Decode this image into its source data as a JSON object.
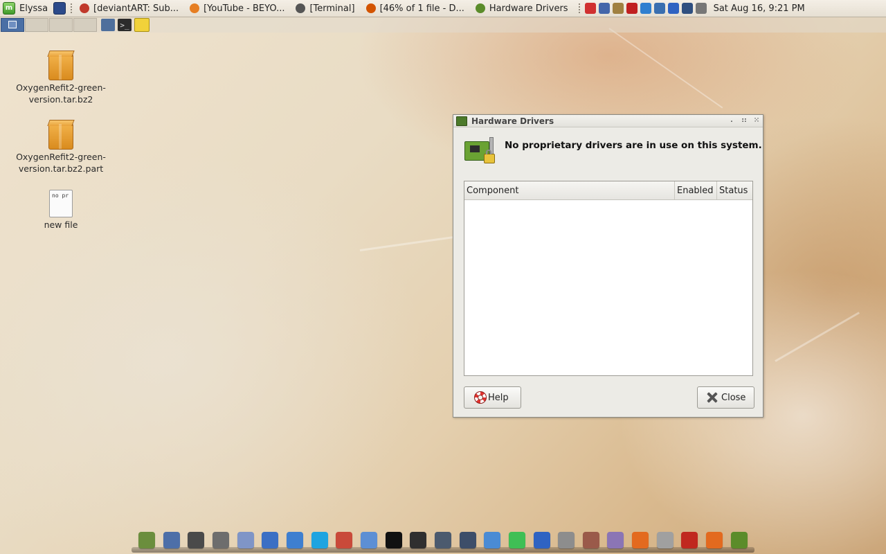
{
  "top_panel": {
    "menu_label": "Elyssa",
    "tasks": [
      {
        "label": "[deviantART: Sub...",
        "icon": "music-player-icon",
        "color": "#c0392b"
      },
      {
        "label": "[YouTube - BEYO...",
        "icon": "firefox-icon",
        "color": "#e67e22"
      },
      {
        "label": "[Terminal]",
        "icon": "terminal-icon",
        "color": "#555555"
      },
      {
        "label": "[46% of 1 file - D...",
        "icon": "download-icon",
        "color": "#d35400"
      },
      {
        "label": "Hardware Drivers",
        "icon": "hardware-drivers-icon",
        "color": "#5b8c2a"
      }
    ],
    "clock": "Sat Aug 16,  9:21 PM"
  },
  "desktop_icons": [
    {
      "line1": "OxygenRefit2-green-",
      "line2": "version.tar.bz2"
    },
    {
      "line1": "OxygenRefit2-green-",
      "line2": "version.tar.bz2.part"
    },
    {
      "line1": "new file",
      "preview": "no pr"
    }
  ],
  "dialog": {
    "title": "Hardware Drivers",
    "message": "No proprietary drivers are in use on this system.",
    "columns": [
      "Component",
      "Enabled",
      "Status"
    ],
    "help_label": "Help",
    "close_label": "Close"
  },
  "dock_icons": [
    {
      "name": "calculator-icon",
      "color": "#6b8e3d"
    },
    {
      "name": "floppy-save-icon",
      "color": "#4d6fa8"
    },
    {
      "name": "monitor-icon",
      "color": "#4a4a4a"
    },
    {
      "name": "video-camera-icon",
      "color": "#6d6d6d"
    },
    {
      "name": "web-globe-icon",
      "color": "#7f95c7"
    },
    {
      "name": "notes-icon",
      "color": "#3b6fc4"
    },
    {
      "name": "globe-icon",
      "color": "#3e7fd0"
    },
    {
      "name": "skype-icon",
      "color": "#1fa4e0"
    },
    {
      "name": "calendar-icon",
      "color": "#c94a3a"
    },
    {
      "name": "blender-icon",
      "color": "#5d8fd4"
    },
    {
      "name": "aim-icon",
      "color": "#111111"
    },
    {
      "name": "clapperboard-icon",
      "color": "#2f2f2f"
    },
    {
      "name": "speaker-icon",
      "color": "#4b5a6e"
    },
    {
      "name": "mixer-icon",
      "color": "#3d4e69"
    },
    {
      "name": "cursor-icon",
      "color": "#4a8bd4"
    },
    {
      "name": "gem-icon",
      "color": "#3fbf55"
    },
    {
      "name": "bluetooth-icon",
      "color": "#2f63c2"
    },
    {
      "name": "drive-icon",
      "color": "#8d8d8d"
    },
    {
      "name": "package-icon",
      "color": "#9a5a4a"
    },
    {
      "name": "ghost-chat-icon",
      "color": "#8b75b5"
    },
    {
      "name": "firefox-icon",
      "color": "#e36a1f"
    },
    {
      "name": "disk-utility-icon",
      "color": "#a0a0a0"
    },
    {
      "name": "opera-icon",
      "color": "#c0281f"
    },
    {
      "name": "firefox-icon",
      "color": "#e36a1f"
    },
    {
      "name": "hardware-drivers-icon",
      "color": "#5b8c2a"
    }
  ],
  "tray_icons": [
    {
      "name": "no-entry-icon",
      "color": "#d03030"
    },
    {
      "name": "network-icon",
      "color": "#4466aa"
    },
    {
      "name": "lock-icon",
      "color": "#a08040"
    },
    {
      "name": "audio-player-icon",
      "color": "#c02020"
    },
    {
      "name": "dropbox-icon",
      "color": "#2f7fd0"
    },
    {
      "name": "update-icon",
      "color": "#3a6fb0"
    },
    {
      "name": "bluetooth-icon",
      "color": "#2f63c2"
    },
    {
      "name": "signal-icon",
      "color": "#2f4f80"
    },
    {
      "name": "volume-icon",
      "color": "#777777"
    }
  ]
}
